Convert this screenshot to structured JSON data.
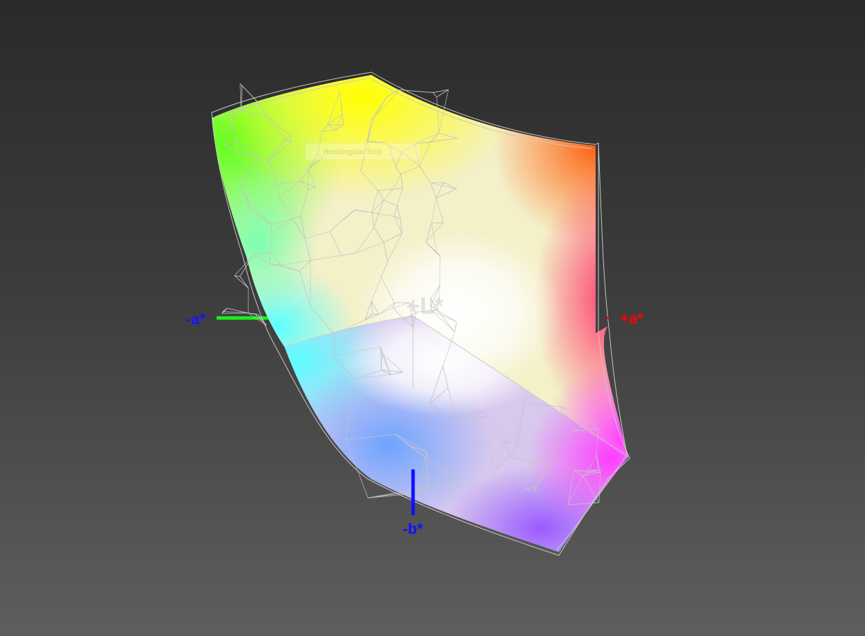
{
  "chart_data": {
    "type": "3d-gamut",
    "description_visible": false,
    "axes": {
      "neg_a": {
        "label": "-a*",
        "color": "#1515ff",
        "line_color": "#1bef1b"
      },
      "pos_a": {
        "label": "+a*",
        "color": "#ff0000"
      },
      "neg_b": {
        "label": "-b*",
        "color": "#1010ff",
        "line_color": "#1010ff"
      },
      "pos_l": {
        "label": "+L*",
        "color": "#d9d9d9"
      }
    },
    "overlay_text": "Rectangular Snip",
    "colors": {
      "background_top": "#2a2a2a",
      "background_bottom": "#5e5e5e",
      "wireframe": "#c8c8c8",
      "green": "#66ff22",
      "yellow": "#ffff10",
      "orange": "#ff6a10",
      "red": "#ff3c64",
      "magenta": "#ff40ff",
      "violet": "#9a5cff",
      "blue": "#6fa0ff",
      "cyan": "#60ffff",
      "white": "#ffffff"
    }
  }
}
